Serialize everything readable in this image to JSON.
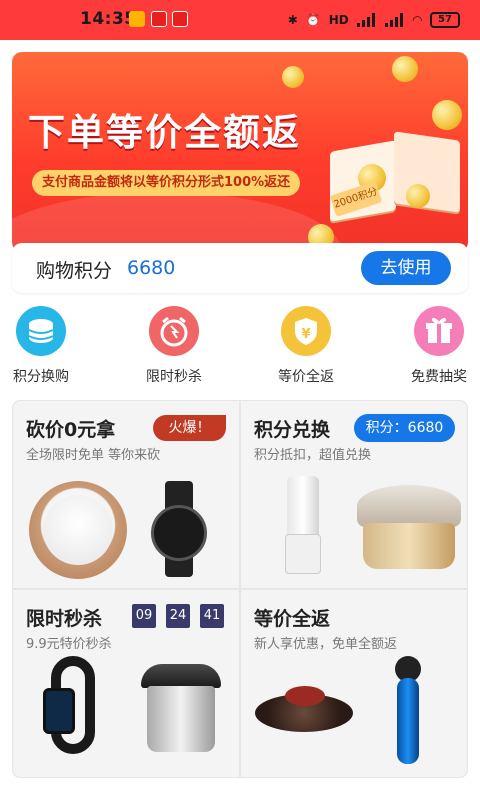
{
  "status_bar": {
    "time": "14:35",
    "network": "HD",
    "battery": "57"
  },
  "banner": {
    "title": "下单等价全额返",
    "subtitle": "支付商品金额将以等价积分形式100%返还",
    "book_label": "2000积分"
  },
  "points": {
    "label": "购物积分",
    "value": "6680",
    "use_button": "去使用"
  },
  "quick_entries": [
    {
      "label": "积分换购",
      "icon": "coin-stack-icon"
    },
    {
      "label": "限时秒杀",
      "icon": "alarm-clock-icon"
    },
    {
      "label": "等价全返",
      "icon": "yen-shield-icon"
    },
    {
      "label": "免费抽奖",
      "icon": "gift-icon"
    }
  ],
  "cards": {
    "bargain": {
      "title": "砍价0元拿",
      "subtitle": "全场限时免单 等你来砍",
      "badge": "火爆！"
    },
    "exchange": {
      "title": "积分兑换",
      "subtitle": "积分抵扣，超值兑换",
      "badge": "积分：6680"
    },
    "flash_sale": {
      "title": "限时秒杀",
      "subtitle": "9.9元特价秒杀",
      "timer": [
        "09",
        "24",
        "41"
      ]
    },
    "equal_return": {
      "title": "等价全返",
      "subtitle": "新人享优惠，免单全额返"
    }
  },
  "colors": {
    "status_bar": "#ff3a3a",
    "accent_blue": "#1677e8",
    "hot_red": "#c23a24",
    "timer_bg": "#3a3a6a"
  }
}
